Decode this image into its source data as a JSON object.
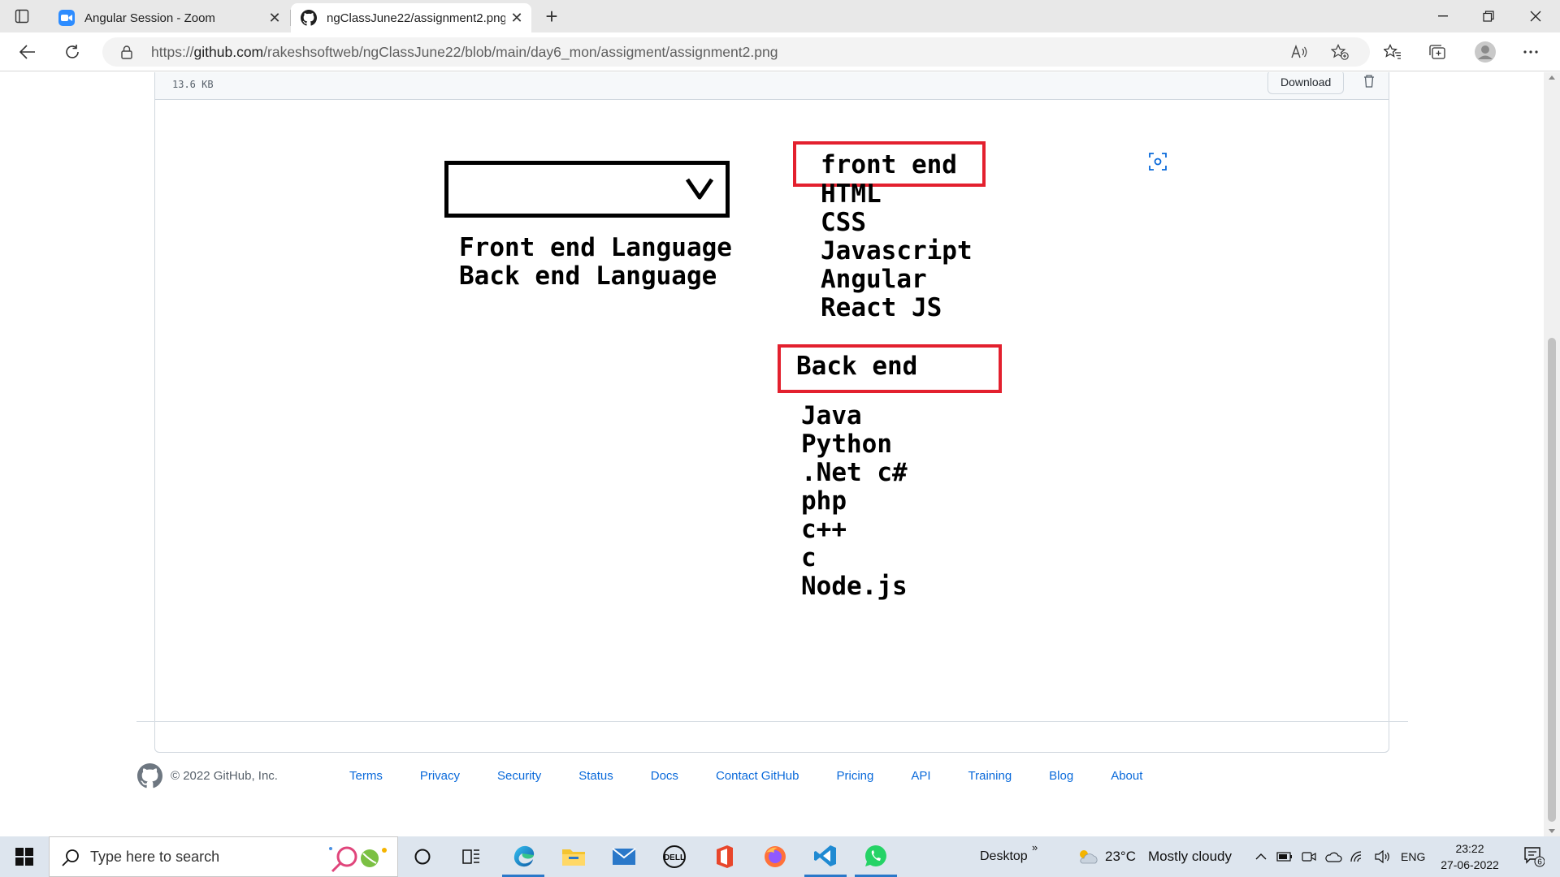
{
  "browser": {
    "tabs": [
      {
        "title": "Angular Session - Zoom",
        "icon": "zoom-icon",
        "active": false
      },
      {
        "title": "ngClassJune22/assignment2.png",
        "icon": "github-icon",
        "active": true
      }
    ],
    "url_prefix": "https://",
    "url_host": "github.com",
    "url_path": "/rakeshsoftweb/ngClassJune22/blob/main/day6_mon/assigment/assignment2.png"
  },
  "file": {
    "size": "13.6 KB",
    "download_label": "Download"
  },
  "image": {
    "options": [
      "Front end Language",
      "Back end Language"
    ],
    "frontend_title": "front end",
    "frontend_items": [
      "HTML",
      "CSS",
      "Javascript",
      "Angular",
      "React JS"
    ],
    "backend_title": "Back end",
    "backend_items": [
      "Java",
      "Python",
      ".Net c#",
      "php",
      "c++",
      "c",
      "Node.js"
    ],
    "accent_red": "#e3202e"
  },
  "footer": {
    "copyright": "© 2022 GitHub, Inc.",
    "links": [
      "Terms",
      "Privacy",
      "Security",
      "Status",
      "Docs",
      "Contact GitHub",
      "Pricing",
      "API",
      "Training",
      "Blog",
      "About"
    ]
  },
  "taskbar": {
    "search_placeholder": "Type here to search",
    "desktop_label": "Desktop",
    "weather_temp": "23°C",
    "weather_desc": "Mostly cloudy",
    "language": "ENG",
    "time": "23:22",
    "date": "27-06-2022",
    "notification_count": "6"
  }
}
